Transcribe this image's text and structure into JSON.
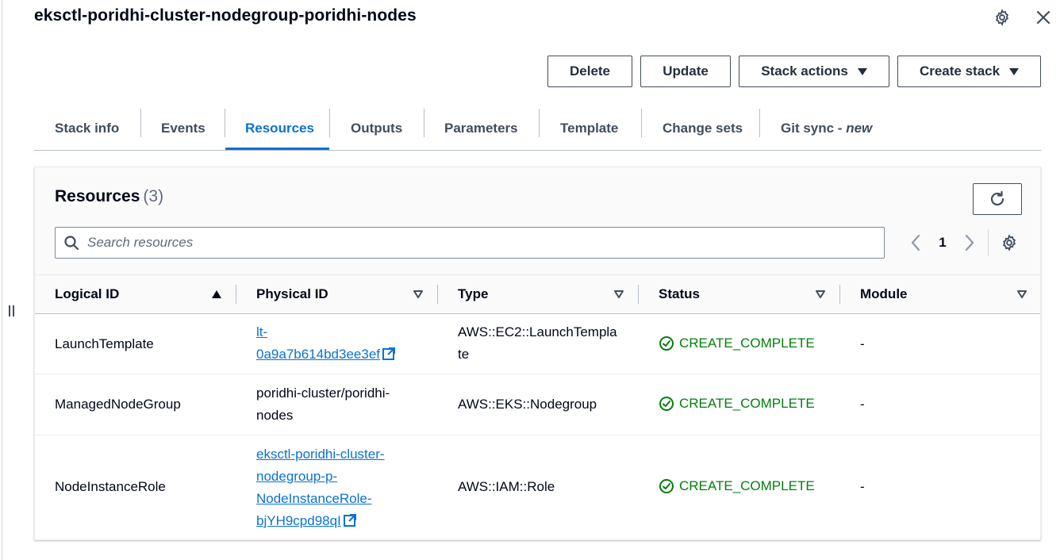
{
  "stack": {
    "title": "eksctl-poridhi-cluster-nodegroup-poridhi-nodes"
  },
  "actions": {
    "delete": "Delete",
    "update": "Update",
    "stack_actions": "Stack actions",
    "create_stack": "Create stack"
  },
  "tabs": [
    {
      "label": "Stack info"
    },
    {
      "label": "Events"
    },
    {
      "label": "Resources",
      "active": true
    },
    {
      "label": "Outputs"
    },
    {
      "label": "Parameters"
    },
    {
      "label": "Template"
    },
    {
      "label": "Change sets"
    },
    {
      "label": "Git sync - ",
      "badge": "new"
    }
  ],
  "resources": {
    "title": "Resources",
    "count": "(3)",
    "search_placeholder": "Search resources",
    "page": "1",
    "columns": {
      "logical_id": "Logical ID",
      "physical_id": "Physical ID",
      "type": "Type",
      "status": "Status",
      "module": "Module"
    },
    "rows": [
      {
        "logical_id": "LaunchTemplate",
        "physical_id_lines": [
          "lt-",
          "0a9a7b614bd3ee3ef"
        ],
        "type_lines": [
          "AWS::EC2::LaunchTempla",
          "te"
        ],
        "status": "CREATE_COMPLETE",
        "module": "-"
      },
      {
        "logical_id": "ManagedNodeGroup",
        "physical_id_lines": [
          "poridhi-cluster/poridhi-",
          "nodes"
        ],
        "type_lines": [
          "AWS::EKS::Nodegroup"
        ],
        "status": "CREATE_COMPLETE",
        "module": "-"
      },
      {
        "logical_id": "NodeInstanceRole",
        "physical_id_lines": [
          "eksctl-poridhi-cluster-",
          "nodegroup-p-",
          "NodeInstanceRole-",
          "bjYH9cpd98qI"
        ],
        "type_lines": [
          "AWS::IAM::Role"
        ],
        "status": "CREATE_COMPLETE",
        "module": "-"
      }
    ]
  },
  "colors": {
    "accent": "#0972d3",
    "success": "#037f0c",
    "text": "#000716",
    "border": "#414d5c"
  }
}
